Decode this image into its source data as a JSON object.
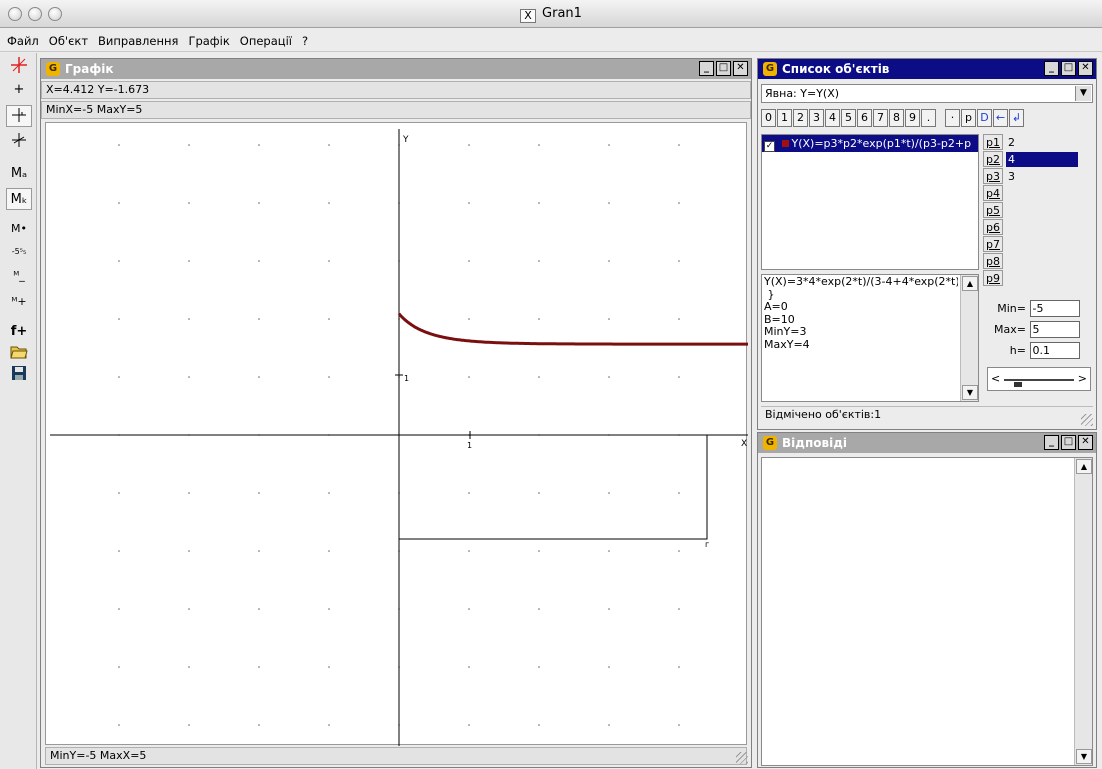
{
  "window": {
    "title": "Gran1",
    "x_glyph": "X"
  },
  "menubar": [
    "Файл",
    "Об'єкт",
    "Виправлення",
    "Графік",
    "Операції",
    "?"
  ],
  "toolbar": {
    "labels": [
      "+",
      "Mₐ",
      "Mₖ",
      "M•",
      "-5⁵₅",
      "ᴹ_",
      "ᴹ+",
      "f+"
    ]
  },
  "graph_window": {
    "title": "Графік",
    "cursor_readout": "X=4.412  Y=-1.673",
    "top_status": "MinX=-5  MaxY=5",
    "bottom_status": "MinY=-5  MaxX=5",
    "axis_x_label": "X",
    "axis_y_label": "Y",
    "tick_x": "1",
    "tick_y": "1",
    "curve_color": "#7a0f0f"
  },
  "objects_window": {
    "title": "Список об'єктів",
    "type_select": "Явна: Y=Y(X)",
    "keys": [
      "0",
      "1",
      "2",
      "3",
      "4",
      "5",
      "6",
      "7",
      "8",
      "9",
      ".",
      "·",
      "p",
      "D",
      "←",
      "↲"
    ],
    "function_item": "Y(X)=p3*p2*exp(p1*t)/(p3-p2+p",
    "params": [
      {
        "name": "p1",
        "value": "2"
      },
      {
        "name": "p2",
        "value": "4"
      },
      {
        "name": "p3",
        "value": "3"
      },
      {
        "name": "p4",
        "value": ""
      },
      {
        "name": "p5",
        "value": ""
      },
      {
        "name": "p6",
        "value": ""
      },
      {
        "name": "p7",
        "value": ""
      },
      {
        "name": "p8",
        "value": ""
      },
      {
        "name": "p9",
        "value": ""
      }
    ],
    "details": [
      "Y(X)=3*4*exp(2*t)/(3-4+4*exp(2*t)",
      " }",
      "A=0",
      "B=10",
      "MinY=3",
      "MaxY=4"
    ],
    "min_label": "Min=",
    "min_value": "-5",
    "max_label": "Max=",
    "max_value": "5",
    "h_label": "h=",
    "h_value": "0.1",
    "status": "Відмічено об'єктів:1"
  },
  "answers_window": {
    "title": "Відповіді"
  },
  "colors": {
    "active_title": "#0c0c86",
    "inactive_title": "#a8a8a8",
    "curve": "#7a0f0f"
  }
}
